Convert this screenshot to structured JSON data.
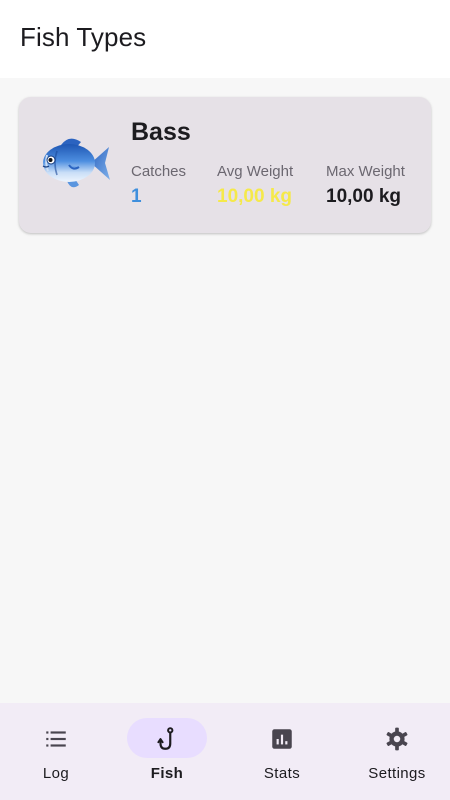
{
  "topbar": {
    "title": "Fish Types"
  },
  "fish_list": [
    {
      "name": "Bass",
      "icon": "fish-emoji-icon",
      "catches_label": "Catches",
      "catches_value": "1",
      "avg_label": "Avg Weight",
      "avg_value": "10,00 kg",
      "max_label": "Max Weight",
      "max_value": "10,00 kg"
    }
  ],
  "bottom_nav": {
    "active": "Fish",
    "items": [
      {
        "label": "Log",
        "icon": "list-icon"
      },
      {
        "label": "Fish",
        "icon": "fishing-hook-icon"
      },
      {
        "label": "Stats",
        "icon": "bar-chart-icon"
      },
      {
        "label": "Settings",
        "icon": "gear-icon"
      }
    ]
  },
  "colors": {
    "catches": "#3f8fdd",
    "avg_weight": "#f5e94a",
    "max_weight": "#1c1b1f",
    "card_bg": "#e6e1e7",
    "nav_bg": "#f2ecf6",
    "nav_active_pill": "#e8ddff"
  }
}
